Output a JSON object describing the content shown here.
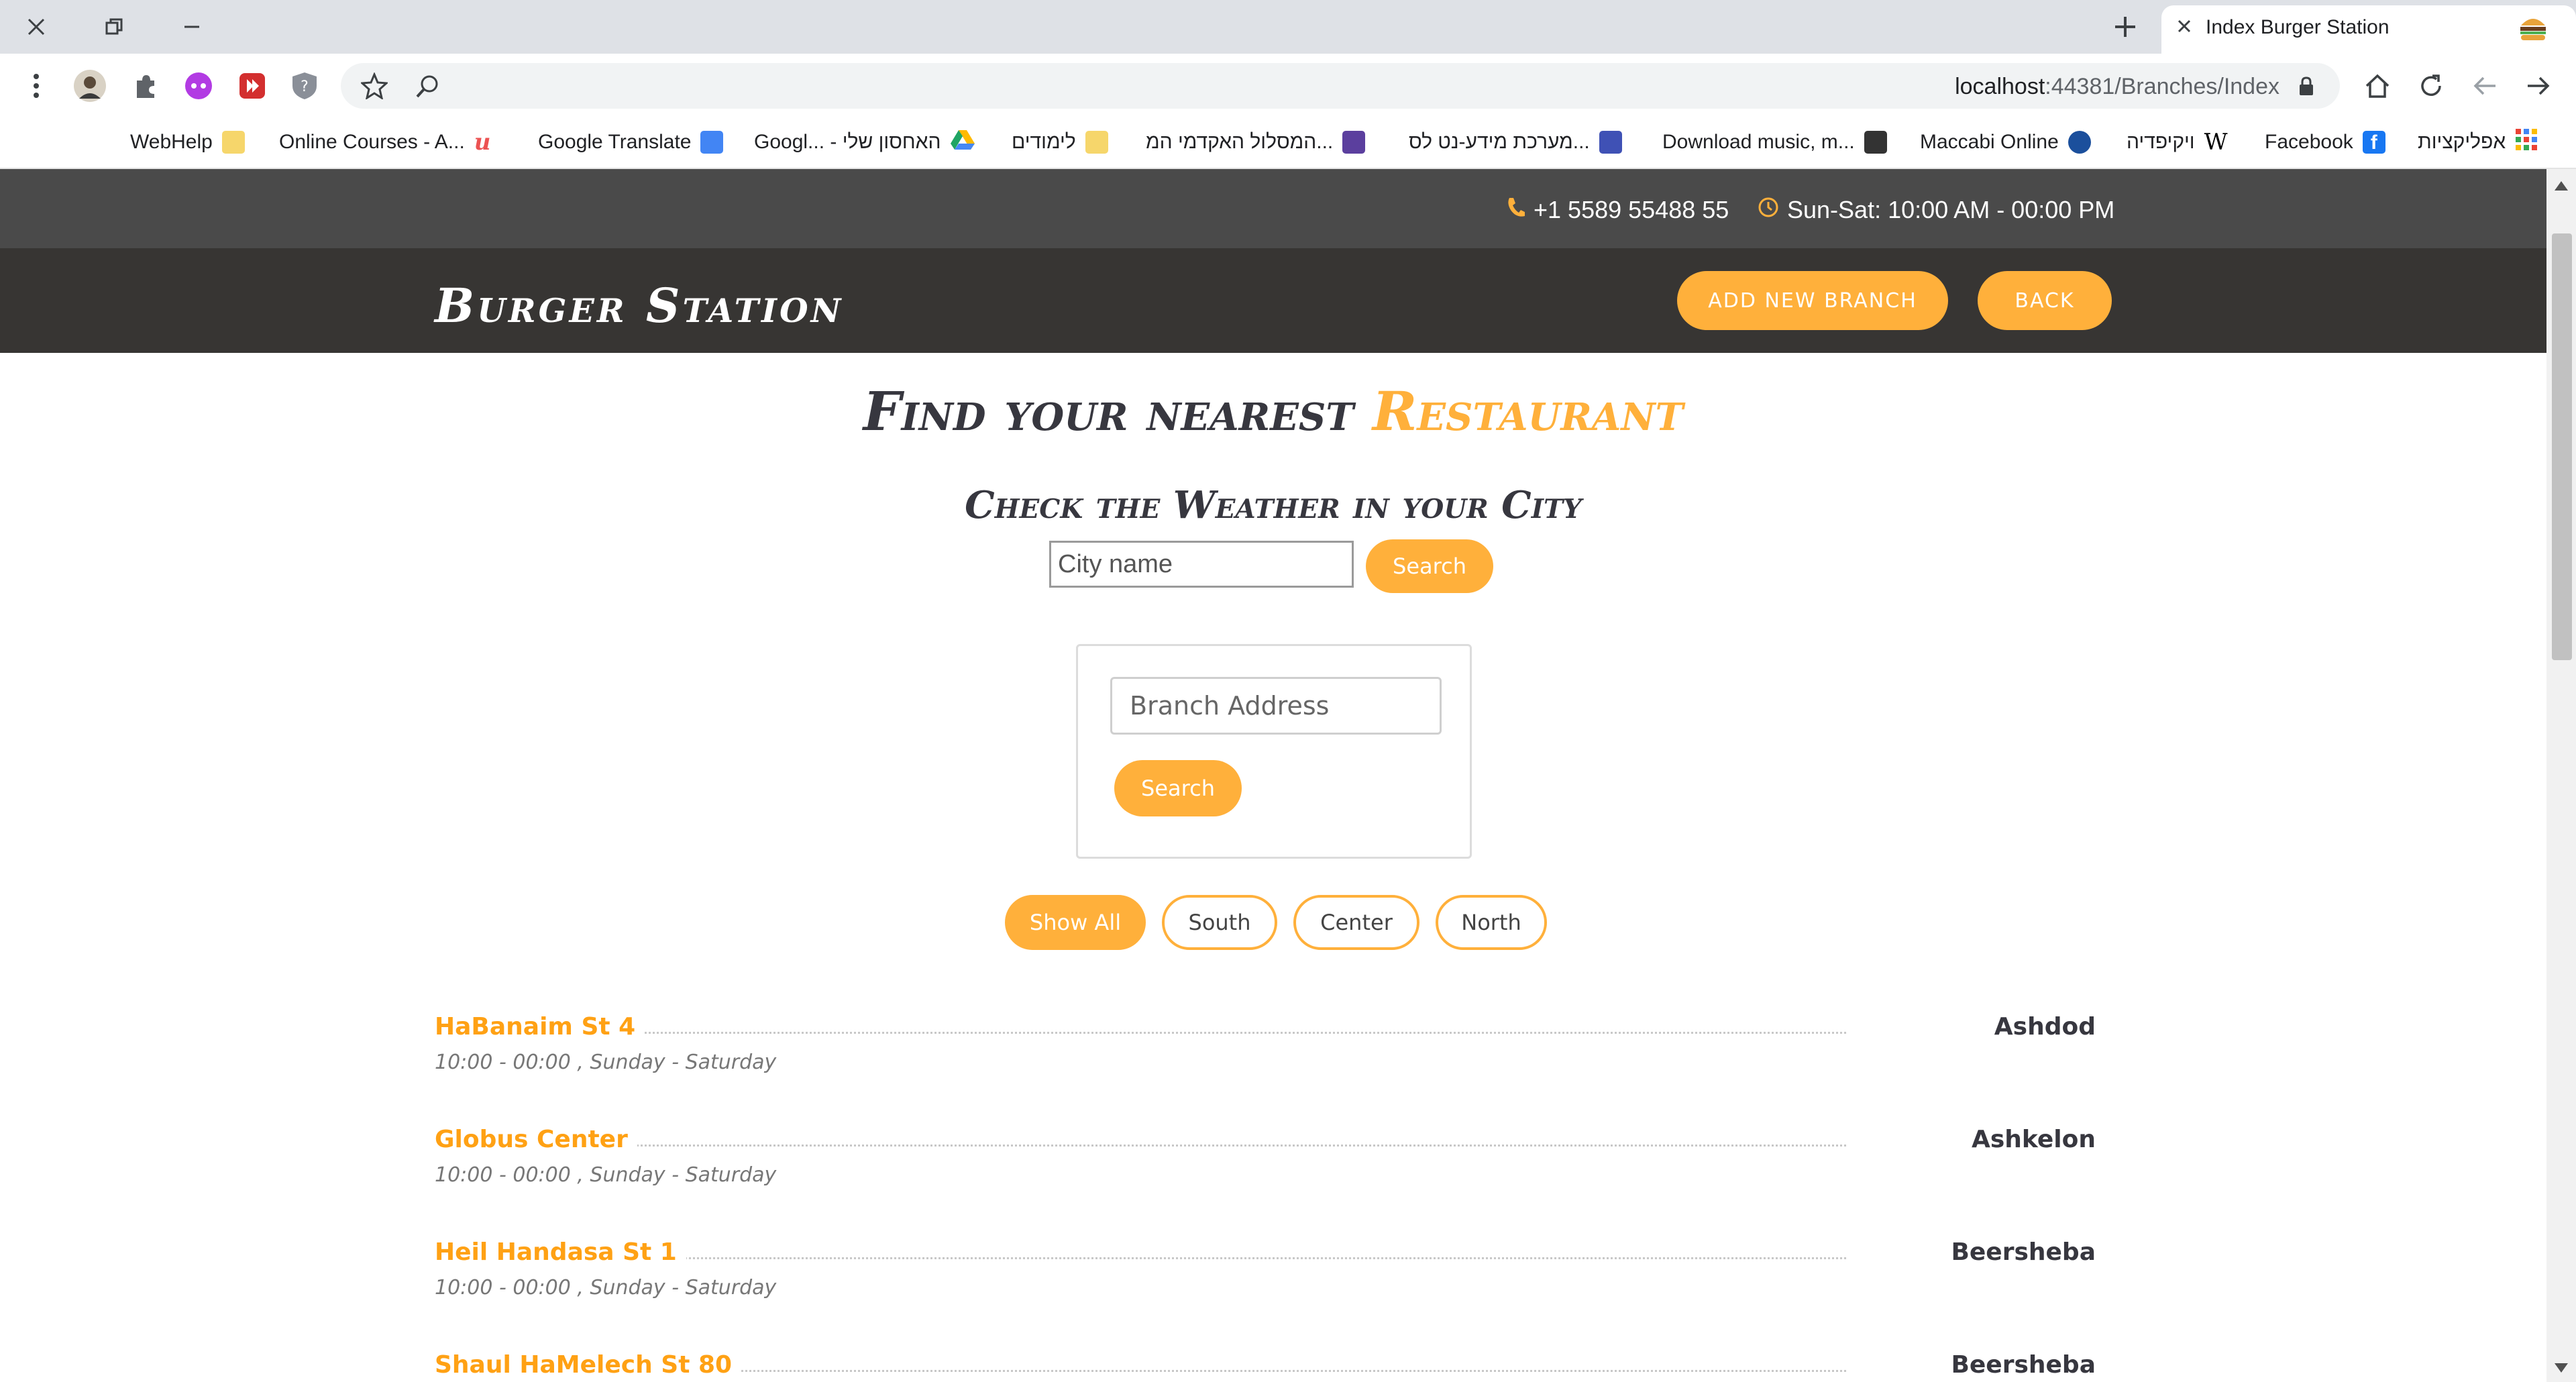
{
  "browser": {
    "tab_title": "Index Burger Station",
    "url_host": "localhost",
    "url_path": ":44381/Branches/Index",
    "bookmarks": [
      {
        "label": "WebHelp",
        "icon": "folder-icon",
        "color": "#f6d66b"
      },
      {
        "label": "Online Courses - A...",
        "icon": "udemy-icon",
        "color": "#ec5252"
      },
      {
        "label": "Google Translate",
        "icon": "translate-icon",
        "color": "#4285f4"
      },
      {
        "label": "Googl... - האחסון שלי",
        "icon": "drive-icon",
        "color": "#1fa463"
      },
      {
        "label": "לימודים",
        "icon": "folder-icon",
        "color": "#f6d66b"
      },
      {
        "label": "המסלול האקדמי המ...",
        "icon": "academic-icon",
        "color": "#5b3f9e"
      },
      {
        "label": "מערכת מידע-נט לס...",
        "icon": "system-icon",
        "color": "#3f51b5"
      },
      {
        "label": "Download music, m...",
        "icon": "music-icon",
        "color": "#333333"
      },
      {
        "label": "Maccabi Online",
        "icon": "maccabi-icon",
        "color": "#1b4f9c"
      },
      {
        "label": "ויקיפדיה",
        "icon": "wikipedia-icon",
        "color": "#000000"
      },
      {
        "label": "Facebook",
        "icon": "facebook-icon",
        "color": "#1877f2"
      },
      {
        "label": "אפליקציות",
        "icon": "apps-grid-icon",
        "color": "#ea4335"
      }
    ]
  },
  "topbar": {
    "phone": "+1 5589 55488 55",
    "hours": "Sun-Sat: 10:00 AM - 00:00 PM",
    "icon_color": "#ffb03b"
  },
  "header": {
    "logo": "Burger Station",
    "add_branch_label": "ADD NEW BRANCH",
    "back_label": "BACK"
  },
  "hero": {
    "title_main": "Find your nearest ",
    "title_accent": "Restaurant"
  },
  "weather": {
    "title": "Check the Weather in your City",
    "placeholder": "City name",
    "search_label": "Search"
  },
  "branch_search": {
    "placeholder": "Branch Address",
    "search_label": "Search"
  },
  "filters": [
    {
      "label": "Show All",
      "active": true
    },
    {
      "label": "South",
      "active": false
    },
    {
      "label": "Center",
      "active": false
    },
    {
      "label": "North",
      "active": false
    }
  ],
  "branches": [
    {
      "address": "HaBanaim St 4",
      "hours": "10:00 - 00:00 , Sunday - Saturday",
      "city": "Ashdod"
    },
    {
      "address": "Globus Center",
      "hours": "10:00 - 00:00 , Sunday - Saturday",
      "city": "Ashkelon"
    },
    {
      "address": "Heil Handasa St 1",
      "hours": "10:00 - 00:00 , Sunday - Saturday",
      "city": "Beersheba"
    },
    {
      "address": "Shaul HaMelech St 80",
      "hours": "",
      "city": "Beersheba"
    }
  ],
  "colors": {
    "accent": "#ffb03b",
    "branch_name": "#ffa114",
    "header_bg": "#373533",
    "topbar_bg": "#4a4a4a"
  }
}
